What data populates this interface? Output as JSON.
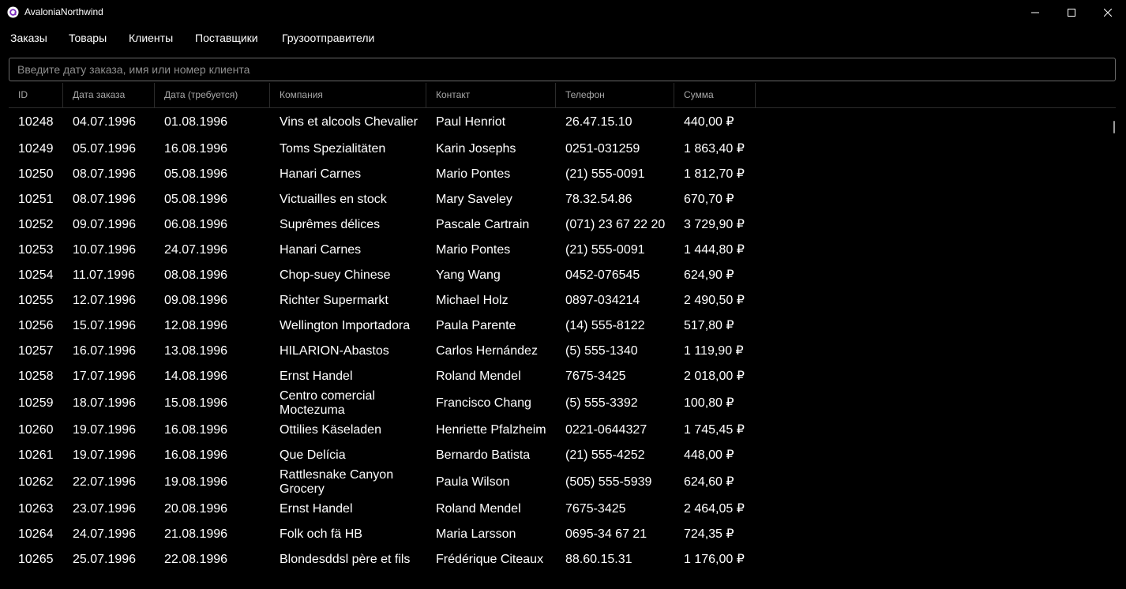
{
  "window": {
    "title": "AvaloniaNorthwind",
    "icon": "avalonia-logo-icon",
    "controls": [
      "minimize-icon",
      "maximize-icon",
      "close-icon"
    ]
  },
  "menu": {
    "items": [
      {
        "label": "Заказы"
      },
      {
        "label": "Товары"
      },
      {
        "label": "Клиенты"
      },
      {
        "label": "Поставщики"
      },
      {
        "label": "Грузоотправители"
      }
    ]
  },
  "search": {
    "placeholder": "Введите дату заказа, имя или номер клиента",
    "value": ""
  },
  "grid": {
    "columns": [
      "ID",
      "Дата заказа",
      "Дата (требуется)",
      "Компания",
      "Контакт",
      "Телефон",
      "Сумма"
    ],
    "rows": [
      [
        "10248",
        "04.07.1996",
        "01.08.1996",
        "Vins et alcools Chevalier",
        "Paul Henriot",
        "26.47.15.10",
        "440,00 ₽"
      ],
      [
        "10249",
        "05.07.1996",
        "16.08.1996",
        "Toms Spezialitäten",
        "Karin Josephs",
        "0251-031259",
        "1 863,40 ₽"
      ],
      [
        "10250",
        "08.07.1996",
        "05.08.1996",
        "Hanari Carnes",
        "Mario Pontes",
        "(21) 555-0091",
        "1 812,70 ₽"
      ],
      [
        "10251",
        "08.07.1996",
        "05.08.1996",
        "Victuailles en stock",
        "Mary Saveley",
        "78.32.54.86",
        "670,70 ₽"
      ],
      [
        "10252",
        "09.07.1996",
        "06.08.1996",
        "Suprêmes délices",
        "Pascale Cartrain",
        "(071) 23 67 22 20",
        "3 729,90 ₽"
      ],
      [
        "10253",
        "10.07.1996",
        "24.07.1996",
        "Hanari Carnes",
        "Mario Pontes",
        "(21) 555-0091",
        "1 444,80 ₽"
      ],
      [
        "10254",
        "11.07.1996",
        "08.08.1996",
        "Chop-suey Chinese",
        "Yang Wang",
        "0452-076545",
        "624,90 ₽"
      ],
      [
        "10255",
        "12.07.1996",
        "09.08.1996",
        "Richter Supermarkt",
        "Michael Holz",
        "0897-034214",
        "2 490,50 ₽"
      ],
      [
        "10256",
        "15.07.1996",
        "12.08.1996",
        "Wellington Importadora",
        "Paula Parente",
        "(14) 555-8122",
        "517,80 ₽"
      ],
      [
        "10257",
        "16.07.1996",
        "13.08.1996",
        "HILARION-Abastos",
        "Carlos Hernández",
        "(5) 555-1340",
        "1 119,90 ₽"
      ],
      [
        "10258",
        "17.07.1996",
        "14.08.1996",
        "Ernst Handel",
        "Roland Mendel",
        "7675-3425",
        "2 018,00 ₽"
      ],
      [
        "10259",
        "18.07.1996",
        "15.08.1996",
        "Centro comercial Moctezuma",
        "Francisco Chang",
        "(5) 555-3392",
        "100,80 ₽"
      ],
      [
        "10260",
        "19.07.1996",
        "16.08.1996",
        "Ottilies Käseladen",
        "Henriette Pfalzheim",
        "0221-0644327",
        "1 745,45 ₽"
      ],
      [
        "10261",
        "19.07.1996",
        "16.08.1996",
        "Que Delícia",
        "Bernardo Batista",
        "(21) 555-4252",
        "448,00 ₽"
      ],
      [
        "10262",
        "22.07.1996",
        "19.08.1996",
        "Rattlesnake Canyon Grocery",
        "Paula Wilson",
        "(505) 555-5939",
        "624,60 ₽"
      ],
      [
        "10263",
        "23.07.1996",
        "20.08.1996",
        "Ernst Handel",
        "Roland Mendel",
        "7675-3425",
        "2 464,05 ₽"
      ],
      [
        "10264",
        "24.07.1996",
        "21.08.1996",
        "Folk och fä HB",
        "Maria Larsson",
        "0695-34 67 21",
        "724,35 ₽"
      ],
      [
        "10265",
        "25.07.1996",
        "22.08.1996",
        "Blondesddsl père et fils",
        "Frédérique Citeaux",
        "88.60.15.31",
        "1 176,00 ₽"
      ]
    ]
  }
}
